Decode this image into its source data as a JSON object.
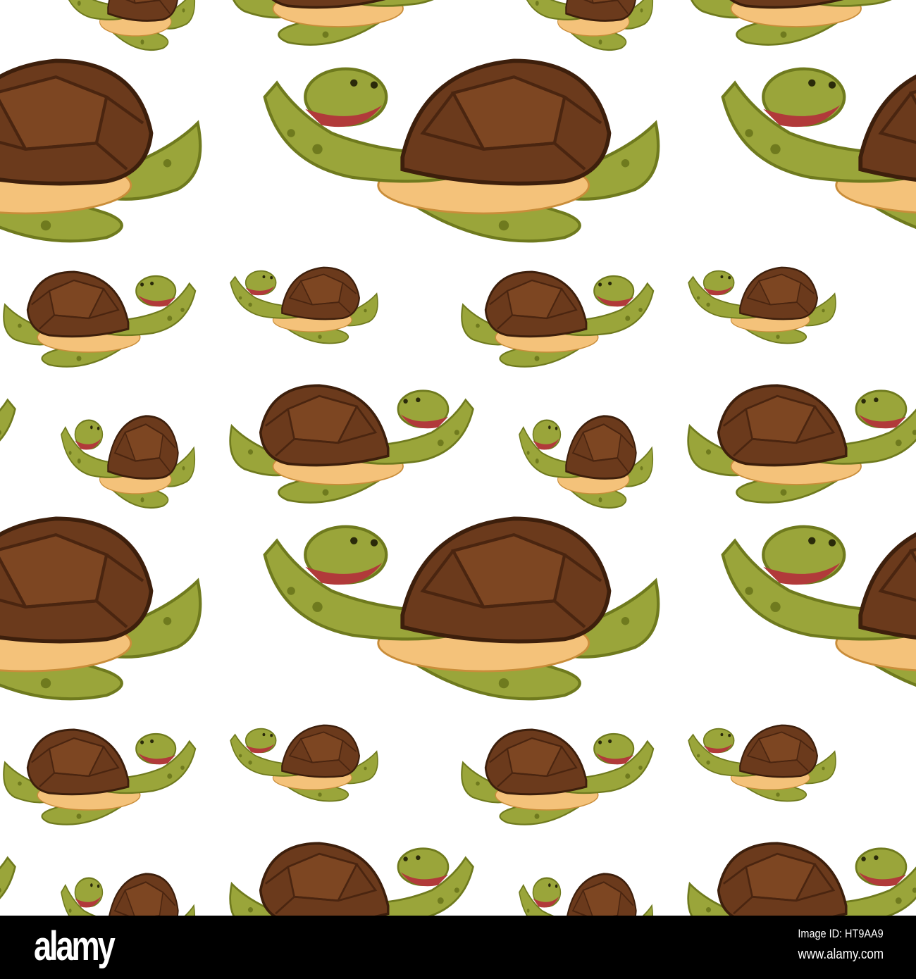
{
  "pattern": {
    "subject": "sea-turtle",
    "colors": {
      "shell": "#6b3a1c",
      "shell_dark": "#4a2510",
      "skin": "#9aa53a",
      "skin_dark": "#6f7a1e",
      "belly": "#f4c27a",
      "background": "#ffffff"
    }
  },
  "footer": {
    "logo": "alamy",
    "image_id": "Image ID: HT9AA9",
    "website": "www.alamy.com"
  }
}
